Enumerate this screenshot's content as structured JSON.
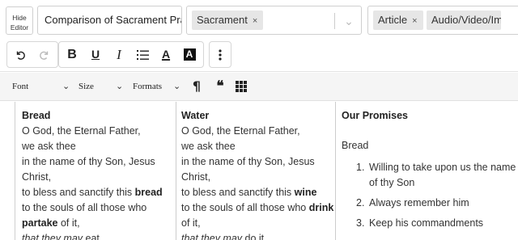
{
  "header": {
    "hide_editor_label": "Hide Editor",
    "title_value": "Comparison of Sacrament Prayers",
    "topics": {
      "chips": [
        "Sacrament"
      ]
    },
    "types": {
      "chips": [
        "Article",
        "Audio/Video/Image"
      ]
    },
    "chip_remove_glyph": "×",
    "dropdown_glyph": "⌄"
  },
  "toolbar": {
    "undo_icon": "undo-icon",
    "redo_icon": "redo-icon",
    "bold_label": "B",
    "underline_label": "U",
    "italic_label": "I",
    "list_icon": "ordered-list-icon",
    "text_color_label": "A",
    "bg_color_label": "A",
    "more_icon": "more-vertical-icon"
  },
  "toolbar2": {
    "font_label": "Font",
    "size_label": "Size",
    "formats_label": "Formats",
    "paragraph_glyph": "¶",
    "quote_glyph": "❝",
    "table_icon": "table-icon",
    "chevron_glyph": "⌄"
  },
  "content": {
    "col1": {
      "heading": "Bread",
      "lines": [
        [
          {
            "t": "O God, the Eternal Father,"
          }
        ],
        [
          {
            "t": "we ask thee"
          }
        ],
        [
          {
            "t": "in the name of thy Son, Jesus Christ,"
          }
        ],
        [
          {
            "t": "to bless and sanctify this "
          },
          {
            "t": "bread",
            "b": true
          }
        ],
        [
          {
            "t": "to the souls of all those who "
          },
          {
            "t": "partake",
            "b": true
          },
          {
            "t": " of it,"
          }
        ],
        [
          {
            "t": "that they may",
            "i": true
          },
          {
            "t": " eat"
          }
        ]
      ]
    },
    "col2": {
      "heading": "Water",
      "lines": [
        [
          {
            "t": "O God, the Eternal Father,"
          }
        ],
        [
          {
            "t": "we ask thee"
          }
        ],
        [
          {
            "t": "in the name of thy Son, Jesus Christ,"
          }
        ],
        [
          {
            "t": "to bless and sanctify this "
          },
          {
            "t": "wine",
            "b": true
          }
        ],
        [
          {
            "t": "to the souls of all those who "
          },
          {
            "t": "drink",
            "b": true
          },
          {
            "t": " of it,"
          }
        ],
        [
          {
            "t": "that they may",
            "i": true
          },
          {
            "t": " do it"
          }
        ]
      ]
    },
    "col3": {
      "heading": "Our Promises",
      "lead": "Bread",
      "items": [
        {
          "num": "1.",
          "text": "Willing to take upon us the name of thy Son"
        },
        {
          "num": "2.",
          "text": "Always remember him"
        },
        {
          "num": "3.",
          "text": "Keep his commandments"
        }
      ]
    }
  },
  "colors": {
    "border": "#cfcfcf",
    "chip_bg": "#e6e6e6",
    "toolbar2_bg": "#f5f5f5",
    "text": "#333333"
  }
}
